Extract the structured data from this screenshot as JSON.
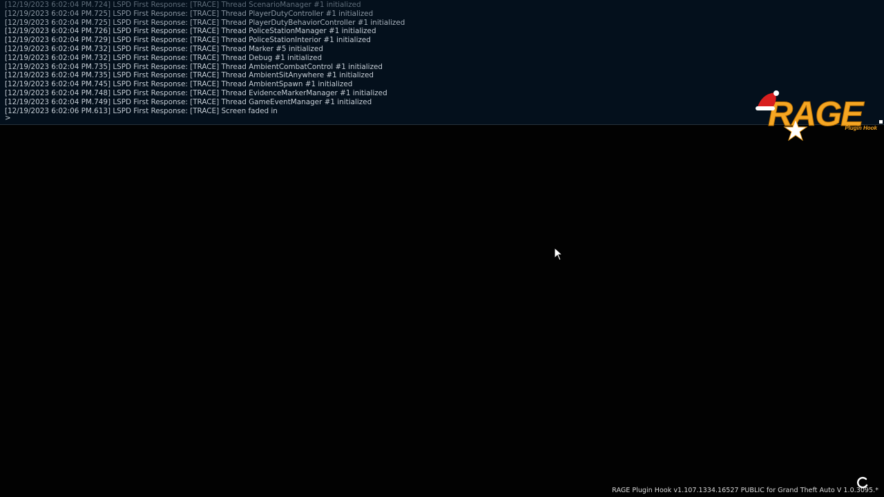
{
  "console": {
    "lines": [
      "[12/19/2023 6:02:04 PM.724] LSPD First Response: [TRACE] Thread ScenarioManager #1 initialized",
      "[12/19/2023 6:02:04 PM.725] LSPD First Response: [TRACE] Thread PlayerDutyController #1 initialized",
      "[12/19/2023 6:02:04 PM.725] LSPD First Response: [TRACE] Thread PlayerDutyBehaviorController #1 initialized",
      "[12/19/2023 6:02:04 PM.726] LSPD First Response: [TRACE] Thread PoliceStationManager #1 initialized",
      "[12/19/2023 6:02:04 PM.729] LSPD First Response: [TRACE] Thread PoliceStationInterior #1 initialized",
      "[12/19/2023 6:02:04 PM.732] LSPD First Response: [TRACE] Thread Marker #5 initialized",
      "[12/19/2023 6:02:04 PM.732] LSPD First Response: [TRACE] Thread Debug #1 initialized",
      "[12/19/2023 6:02:04 PM.735] LSPD First Response: [TRACE] Thread AmbientCombatControl #1 initialized",
      "[12/19/2023 6:02:04 PM.735] LSPD First Response: [TRACE] Thread AmbientSitAnywhere #1 initialized",
      "[12/19/2023 6:02:04 PM.745] LSPD First Response: [TRACE] Thread AmbientSpawn #1 initialized",
      "[12/19/2023 6:02:04 PM.748] LSPD First Response: [TRACE] Thread EvidenceMarkerManager #1 initialized",
      "[12/19/2023 6:02:04 PM.749] LSPD First Response: [TRACE] Thread GameEventManager #1 initialized",
      "[12/19/2023 6:02:06 PM.613] LSPD First Response: [TRACE] Screen faded in"
    ],
    "prompt": ">"
  },
  "logo": {
    "text": "RAGE",
    "subtext": "Plugin Hook",
    "color": "#f5a623",
    "icons": [
      "santa-hat-icon",
      "star-icon"
    ]
  },
  "footer": {
    "version": "RAGE Plugin Hook v1.107.1334.16527 PUBLIC for Grand Theft Auto V 1.0.3095.*"
  },
  "icons": {
    "cursor": "mouse-pointer-icon",
    "spinner": "loading-spinner-icon"
  }
}
